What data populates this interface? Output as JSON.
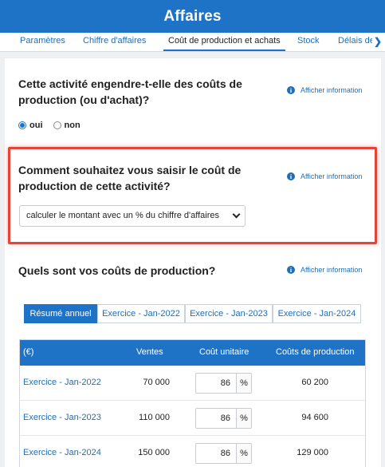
{
  "header": {
    "title": "Affaires"
  },
  "tabs": [
    {
      "label": "Paramètres",
      "active": false
    },
    {
      "label": "Chiffre d'affaires",
      "active": false
    },
    {
      "label": "Coût de production et achats",
      "active": true
    },
    {
      "label": "Stock",
      "active": false
    },
    {
      "label": "Délais de",
      "active": false
    }
  ],
  "info_label": "Afficher information",
  "q1": {
    "title_line1": "Cette activité engendre-t-elle des coûts de",
    "title_line2": "production (ou d'achat)?",
    "options": [
      {
        "label": "oui",
        "checked": true
      },
      {
        "label": "non",
        "checked": false
      }
    ]
  },
  "q2": {
    "title_line1": "Comment souhaitez vous saisir le coût de",
    "title_line2": "production de cette activité?",
    "select_value": "calculer le montant avec un % du chiffre d'affaires"
  },
  "q3": {
    "title": "Quels sont vos coûts de production?",
    "segments": [
      {
        "label": "Résumé annuel",
        "active": true
      },
      {
        "label": "Exercice - Jan-2022",
        "active": false
      },
      {
        "label": "Exercice - Jan-2023",
        "active": false
      },
      {
        "label": "Exercice - Jan-2024",
        "active": false
      }
    ],
    "table": {
      "headers": [
        "(€)",
        "Ventes",
        "Coût unitaire",
        "Coûts de production"
      ],
      "unit_symbol": "%",
      "rows": [
        {
          "year": "Exercice - Jan-2022",
          "sales": "70 000",
          "unit_cost": "86",
          "production_cost": "60 200"
        },
        {
          "year": "Exercice - Jan-2023",
          "sales": "110 000",
          "unit_cost": "86",
          "production_cost": "94 600"
        },
        {
          "year": "Exercice - Jan-2024",
          "sales": "150 000",
          "unit_cost": "86",
          "production_cost": "129 000"
        }
      ]
    }
  },
  "colors": {
    "brand": "#1f73c7",
    "link": "#1f6fb8",
    "highlight": "#e2463a"
  }
}
